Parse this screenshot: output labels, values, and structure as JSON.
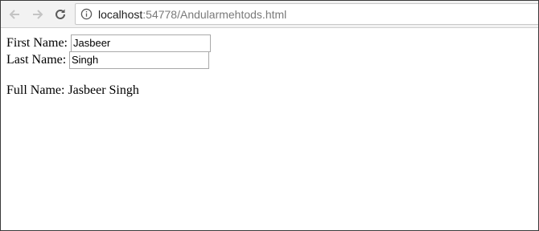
{
  "browser": {
    "url_host": "localhost",
    "url_path": ":54778/Andularmehtods.html",
    "icons": {
      "back": "arrow-left-icon",
      "forward": "arrow-right-icon",
      "reload": "reload-icon",
      "info": "info-circle-icon"
    }
  },
  "form": {
    "first_name_label": "First Name:",
    "first_name_value": "Jasbeer",
    "last_name_label": "Last Name:",
    "last_name_value": "Singh",
    "full_name_text": "Full Name: Jasbeer Singh"
  },
  "colors": {
    "toolbar_bg": "#f2f2f2",
    "page_bg": "#ffffff",
    "url_path": "#7a7a7a"
  }
}
